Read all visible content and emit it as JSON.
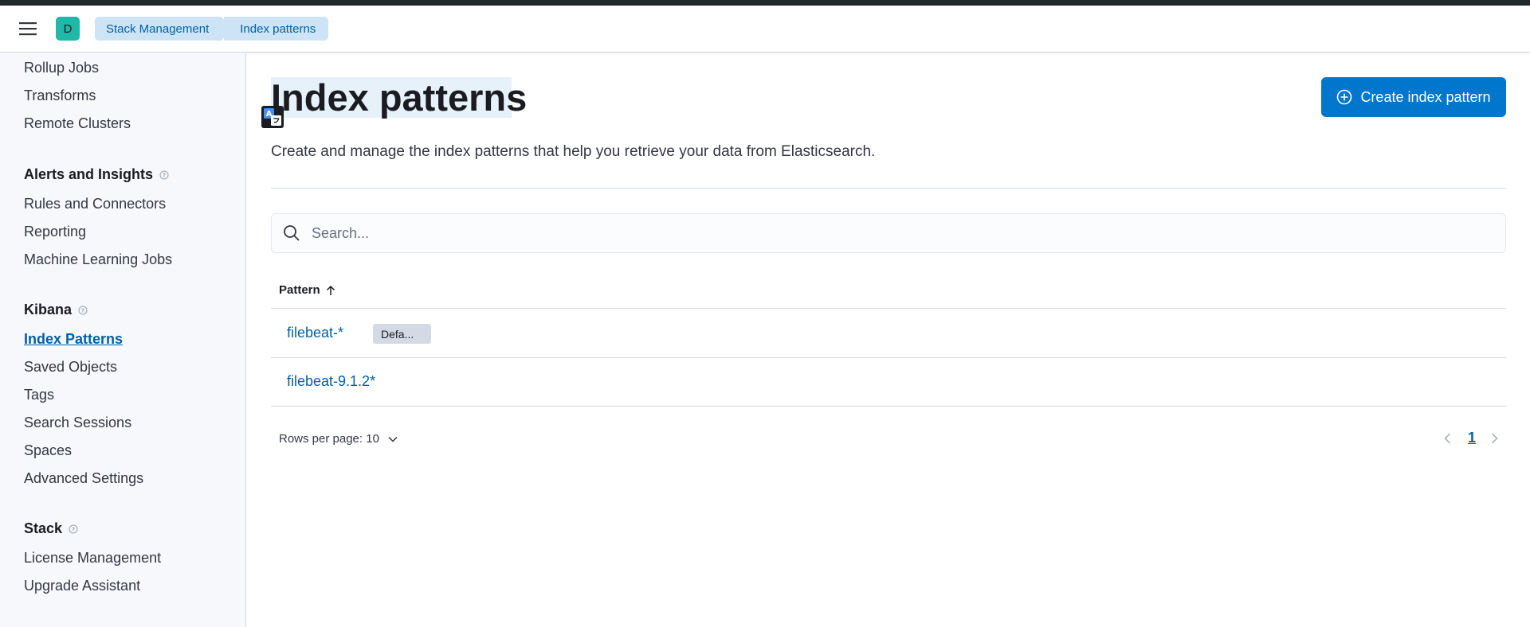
{
  "header": {
    "space_initial": "D",
    "breadcrumbs": [
      "Stack Management",
      "Index patterns"
    ]
  },
  "sidebar": {
    "items_top": [
      "Rollup Jobs",
      "Transforms",
      "Remote Clusters"
    ],
    "groups": [
      {
        "title": "Alerts and Insights",
        "items": [
          "Rules and Connectors",
          "Reporting",
          "Machine Learning Jobs"
        ]
      },
      {
        "title": "Kibana",
        "items": [
          "Index Patterns",
          "Saved Objects",
          "Tags",
          "Search Sessions",
          "Spaces",
          "Advanced Settings"
        ]
      },
      {
        "title": "Stack",
        "items": [
          "License Management",
          "Upgrade Assistant"
        ]
      }
    ],
    "active_item": "Index Patterns"
  },
  "main": {
    "title": "Index patterns",
    "create_button_label": "Create index pattern",
    "description": "Create and manage the index patterns that help you retrieve your data from Elasticsearch.",
    "search_placeholder": "Search...",
    "table": {
      "column_header": "Pattern",
      "rows": [
        {
          "pattern": "filebeat-*",
          "badge": "Defa..."
        },
        {
          "pattern": "filebeat-9.1.2*",
          "badge": ""
        }
      ]
    },
    "rows_per_page_label": "Rows per page: 10",
    "current_page": "1"
  },
  "colors": {
    "primary": "#0077cc",
    "link": "#0061a6",
    "breadcrumb_bg": "#cce4f5",
    "avatar": "#20b8a9"
  }
}
